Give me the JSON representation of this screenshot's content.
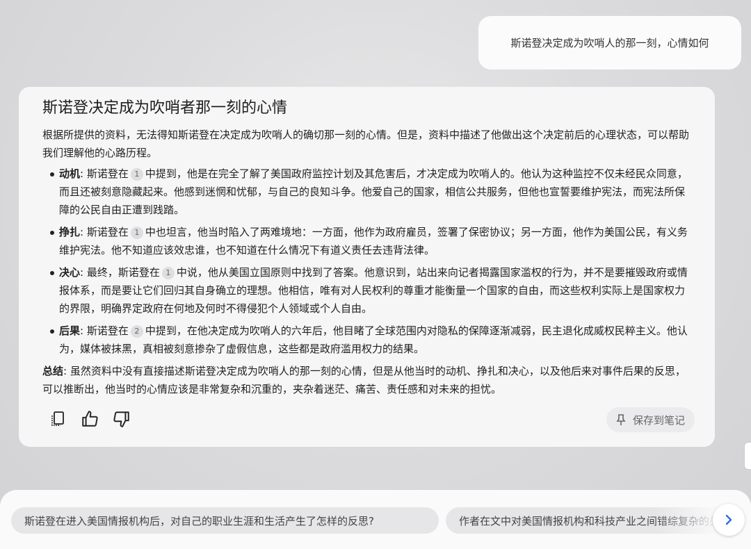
{
  "user_message": "斯诺登决定成为吹哨人的那一刻，心情如何",
  "answer": {
    "title": "斯诺登决定成为吹哨者那一刻的心情",
    "intro": "根据所提供的资料，无法得知斯诺登在决定成为吹哨人的确切那一刻的心情。但是，资料中描述了他做出这个决定前后的心理状态，可以帮助我们理解他的心路历程。",
    "bullets": [
      {
        "label": "动机",
        "pre": ": 斯诺登在",
        "cite": "1",
        "text": "中提到，他是在完全了解了美国政府监控计划及其危害后，才决定成为吹哨人的。他认为这种监控不仅未经民众同意，而且还被刻意隐藏起来。他感到迷惘和忧郁，与自己的良知斗争。他爱自己的国家，相信公共服务，但他也宣誓要维护宪法，而宪法所保障的公民自由正遭到践踏。"
      },
      {
        "label": "挣扎",
        "pre": ": 斯诺登在",
        "cite": "1",
        "text": "中也坦言，他当时陷入了两难境地：一方面，他作为政府雇员，签署了保密协议；另一方面，他作为美国公民，有义务维护宪法。他不知道应该效忠谁，也不知道在什么情况下有道义责任去违背法律。"
      },
      {
        "label": "决心",
        "pre": ": 最终，斯诺登在",
        "cite": "1",
        "text": "中说，他从美国立国原则中找到了答案。他意识到，站出来向记者揭露国家滥权的行为，并不是要摧毁政府或情报体系，而是要让它们回归其自身确立的理想。他相信，唯有对人民权利的尊重才能衡量一个国家的自由，而这些权利实际上是国家权力的界限，明确界定政府在何地及何时不得侵犯个人领域或个人自由。"
      },
      {
        "label": "后果",
        "pre": ": 斯诺登在",
        "cite": "2",
        "text": "中提到，在他决定成为吹哨人的六年后，他目睹了全球范围内对隐私的保障逐渐减弱，民主退化成威权民粹主义。他认为，媒体被抹黑，真相被刻意掺杂了虚假信息，这些都是政府滥用权力的结果。"
      }
    ],
    "summary_label": "总结",
    "summary_text": ": 虽然资料中没有直接描述斯诺登决定成为吹哨人的那一刻的心情，但是从他当时的动机、挣扎和决心，以及他后来对事件后果的反思，可以推断出，他当时的心情应该是非常复杂和沉重的，夹杂着迷茫、痛苦、责任感和对未来的担忧。"
  },
  "actions": {
    "copy_icon": "copy-icon",
    "like_icon": "thumbs-up-icon",
    "dislike_icon": "thumbs-down-icon",
    "save_label": "保存到笔记",
    "save_icon": "pin-icon"
  },
  "suggestions": [
    "斯诺登在进入美国情报机构后，对自己的职业生涯和生活产生了怎样的反思?",
    "作者在文中对美国情报机构和科技产业之间错综复杂的关系"
  ]
}
